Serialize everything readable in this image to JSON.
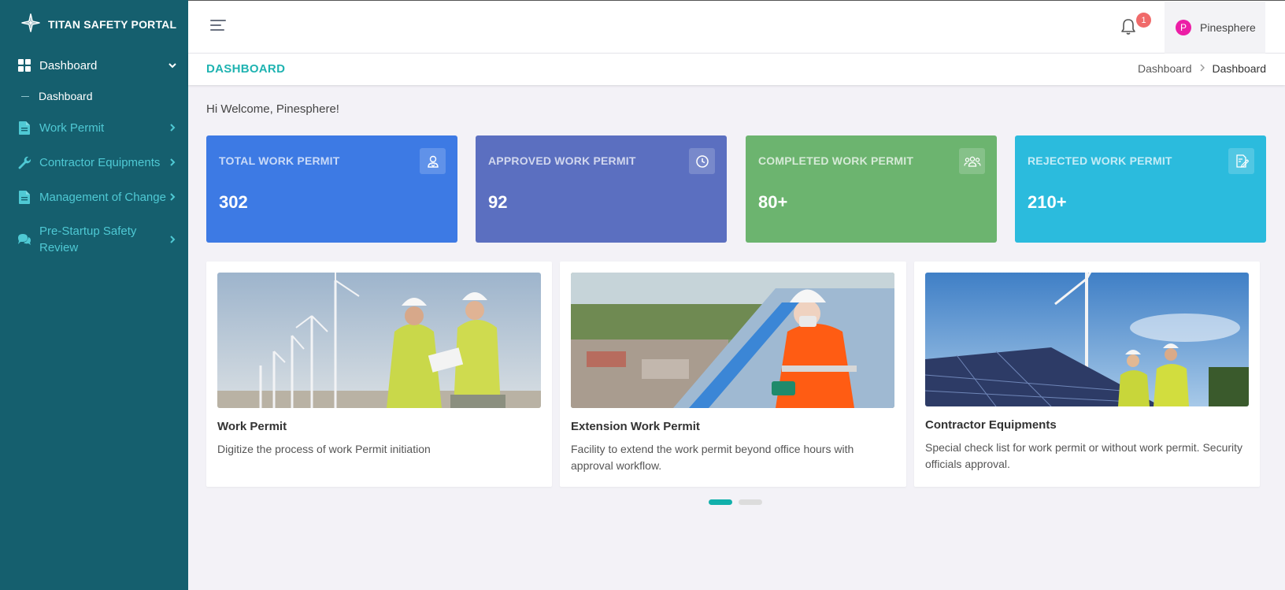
{
  "brand": {
    "title": "TITAN SAFETY PORTAL"
  },
  "sidebar": {
    "items": [
      {
        "label": "Dashboard",
        "icon": "grid-icon"
      },
      {
        "label": "Dashboard",
        "sub": true
      },
      {
        "label": "Work Permit",
        "icon": "document-icon"
      },
      {
        "label": "Contractor Equipments",
        "icon": "wrench-icon"
      },
      {
        "label": "Management of Change",
        "icon": "document-icon"
      },
      {
        "label": "Pre-Startup Safety Review",
        "icon": "chat-icon"
      }
    ]
  },
  "topbar": {
    "notification_count": "1",
    "user": {
      "initial": "P",
      "name": "Pinesphere"
    }
  },
  "titlebar": {
    "title": "DASHBOARD",
    "breadcrumb": [
      "Dashboard",
      "Dashboard"
    ]
  },
  "welcome": "Hi Welcome, Pinesphere!",
  "stats": [
    {
      "label": "TOTAL WORK PERMIT",
      "value": "302",
      "icon": "user-badge-icon",
      "color": "#3d7ae4"
    },
    {
      "label": "APPROVED WORK PERMIT",
      "value": "92",
      "icon": "clock-icon",
      "color": "#5b6fc0"
    },
    {
      "label": "COMPLETED WORK PERMIT",
      "value": "80+",
      "icon": "team-icon",
      "color": "#6cb46f"
    },
    {
      "label": "REJECTED WORK PERMIT",
      "value": "210+",
      "icon": "edit-document-icon",
      "color": "#2bbbdd"
    }
  ],
  "features": [
    {
      "title": "Work Permit",
      "description": "Digitize the process of work Permit initiation"
    },
    {
      "title": "Extension Work Permit",
      "description": "Facility to extend the work permit beyond office hours with approval workflow."
    },
    {
      "title": "Contractor Equipments",
      "description": "Special check list for work permit or without work permit. Security officials approval."
    }
  ],
  "carousel": {
    "pages": 2,
    "active": 1
  }
}
